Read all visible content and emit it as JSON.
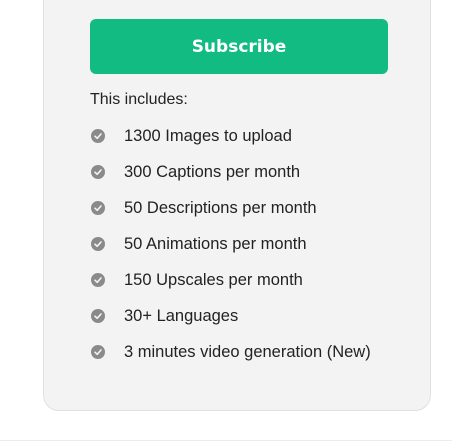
{
  "pricing_card": {
    "subscribe_label": "Subscribe",
    "includes_label": "This includes:",
    "features": [
      {
        "text": "1300 Images to upload",
        "icon": "check-circle-icon"
      },
      {
        "text": "300 Captions per month",
        "icon": "check-circle-icon"
      },
      {
        "text": "50 Descriptions per month",
        "icon": "check-circle-icon"
      },
      {
        "text": "50 Animations per month",
        "icon": "check-circle-icon"
      },
      {
        "text": "150 Upscales per month",
        "icon": "check-circle-icon"
      },
      {
        "text": "30+ Languages",
        "icon": "check-circle-icon"
      },
      {
        "text": "3 minutes video generation (New)",
        "icon": "check-circle-icon"
      }
    ]
  },
  "colors": {
    "accent": "#12bb81",
    "card_background": "#f3f3f3",
    "check_icon": "#8a8a8a",
    "text": "#222222"
  }
}
